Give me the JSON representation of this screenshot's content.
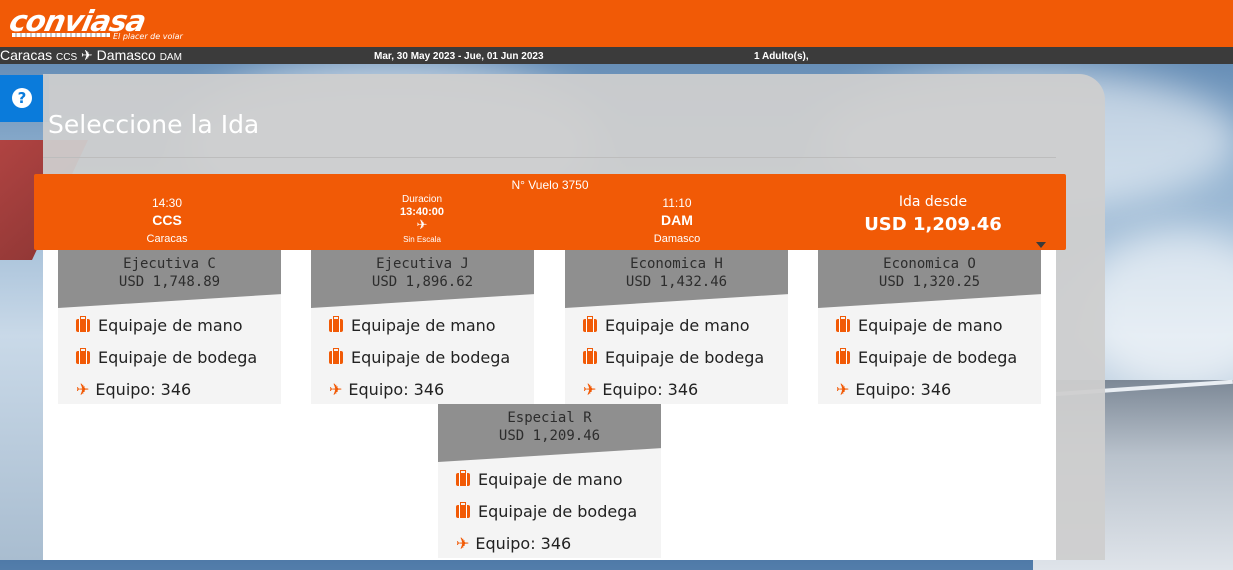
{
  "header": {
    "brand": "conviasa",
    "tagline": "El placer de volar",
    "route": {
      "origin_city": "Caracas",
      "origin_code": "CCS",
      "destination_city": "Damasco",
      "destination_code": "DAM"
    },
    "dates": "Mar, 30 May 2023 - Jue, 01 Jun 2023",
    "passengers": "1 Adulto(s),"
  },
  "help_icon": "question-circle-icon",
  "page_title": "Seleccione la Ida",
  "flight": {
    "number_label": "N° Vuelo 3750",
    "departure": {
      "time": "14:30",
      "code": "CCS",
      "city": "Caracas"
    },
    "duration_label": "Duracion",
    "duration": "13:40:00",
    "stops": "Sin Escala",
    "arrival": {
      "time": "11:10",
      "code": "DAM",
      "city": "Damasco"
    },
    "price_label": "Ida desde",
    "price": "USD 1,209.46"
  },
  "fares": [
    {
      "name": "Ejecutiva C",
      "price": "USD 1,748.89",
      "hand": "Equipaje de mano",
      "hold": "Equipaje de bodega",
      "equip": "Equipo: 346"
    },
    {
      "name": "Ejecutiva J",
      "price": "USD 1,896.62",
      "hand": "Equipaje de mano",
      "hold": "Equipaje de bodega",
      "equip": "Equipo: 346"
    },
    {
      "name": "Economica H",
      "price": "USD 1,432.46",
      "hand": "Equipaje de mano",
      "hold": "Equipaje de bodega",
      "equip": "Equipo: 346"
    },
    {
      "name": "Economica O",
      "price": "USD 1,320.25",
      "hand": "Equipaje de mano",
      "hold": "Equipaje de bodega",
      "equip": "Equipo: 346"
    },
    {
      "name": "Especial R",
      "price": "USD 1,209.46",
      "hand": "Equipaje de mano",
      "hold": "Equipaje de bodega",
      "equip": "Equipo: 346"
    }
  ],
  "colors": {
    "brand_orange": "#f15a06",
    "help_blue": "#0a7bdb",
    "bar_dark": "#3b3b3b"
  }
}
